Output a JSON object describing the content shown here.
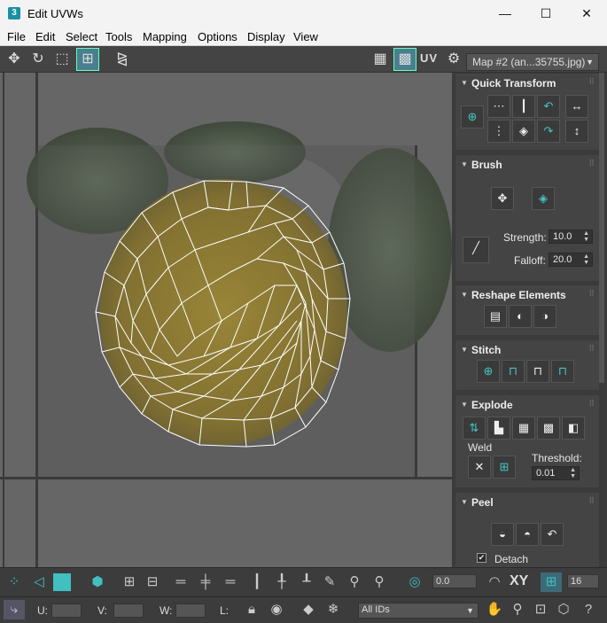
{
  "window": {
    "title": "Edit UVWs",
    "minimize": "—",
    "maximize": "☐",
    "close": "✕",
    "app_icon": "3"
  },
  "menu": [
    "File",
    "Edit",
    "Select",
    "Tools",
    "Mapping",
    "Options",
    "Display",
    "View"
  ],
  "toolbar": {
    "uv_label": "UV",
    "map_selector": "Map #2 (an...35755.jpg)"
  },
  "panels": {
    "quick_transform": {
      "title": "Quick Transform"
    },
    "brush": {
      "title": "Brush",
      "strength_label": "Strength:",
      "strength_value": "10.0",
      "falloff_label": "Falloff:",
      "falloff_value": "20.0"
    },
    "reshape": {
      "title": "Reshape Elements"
    },
    "stitch": {
      "title": "Stitch"
    },
    "explode": {
      "title": "Explode",
      "weld_label": "Weld",
      "threshold_label": "Threshold:",
      "threshold_value": "0.01"
    },
    "peel": {
      "title": "Peel",
      "detach_label": "Detach",
      "detach_checked": true
    }
  },
  "bottom_toolbar": {
    "angle_value": "0.0",
    "xy_label": "XY",
    "grid_value": "16"
  },
  "status_bar": {
    "u_label": "U:",
    "v_label": "V:",
    "w_label": "W:",
    "l_label": "L:",
    "id_filter": "All IDs"
  },
  "colors": {
    "accent": "#40c0c0",
    "panel_bg": "#444444",
    "viewport_bg": "#666666"
  }
}
